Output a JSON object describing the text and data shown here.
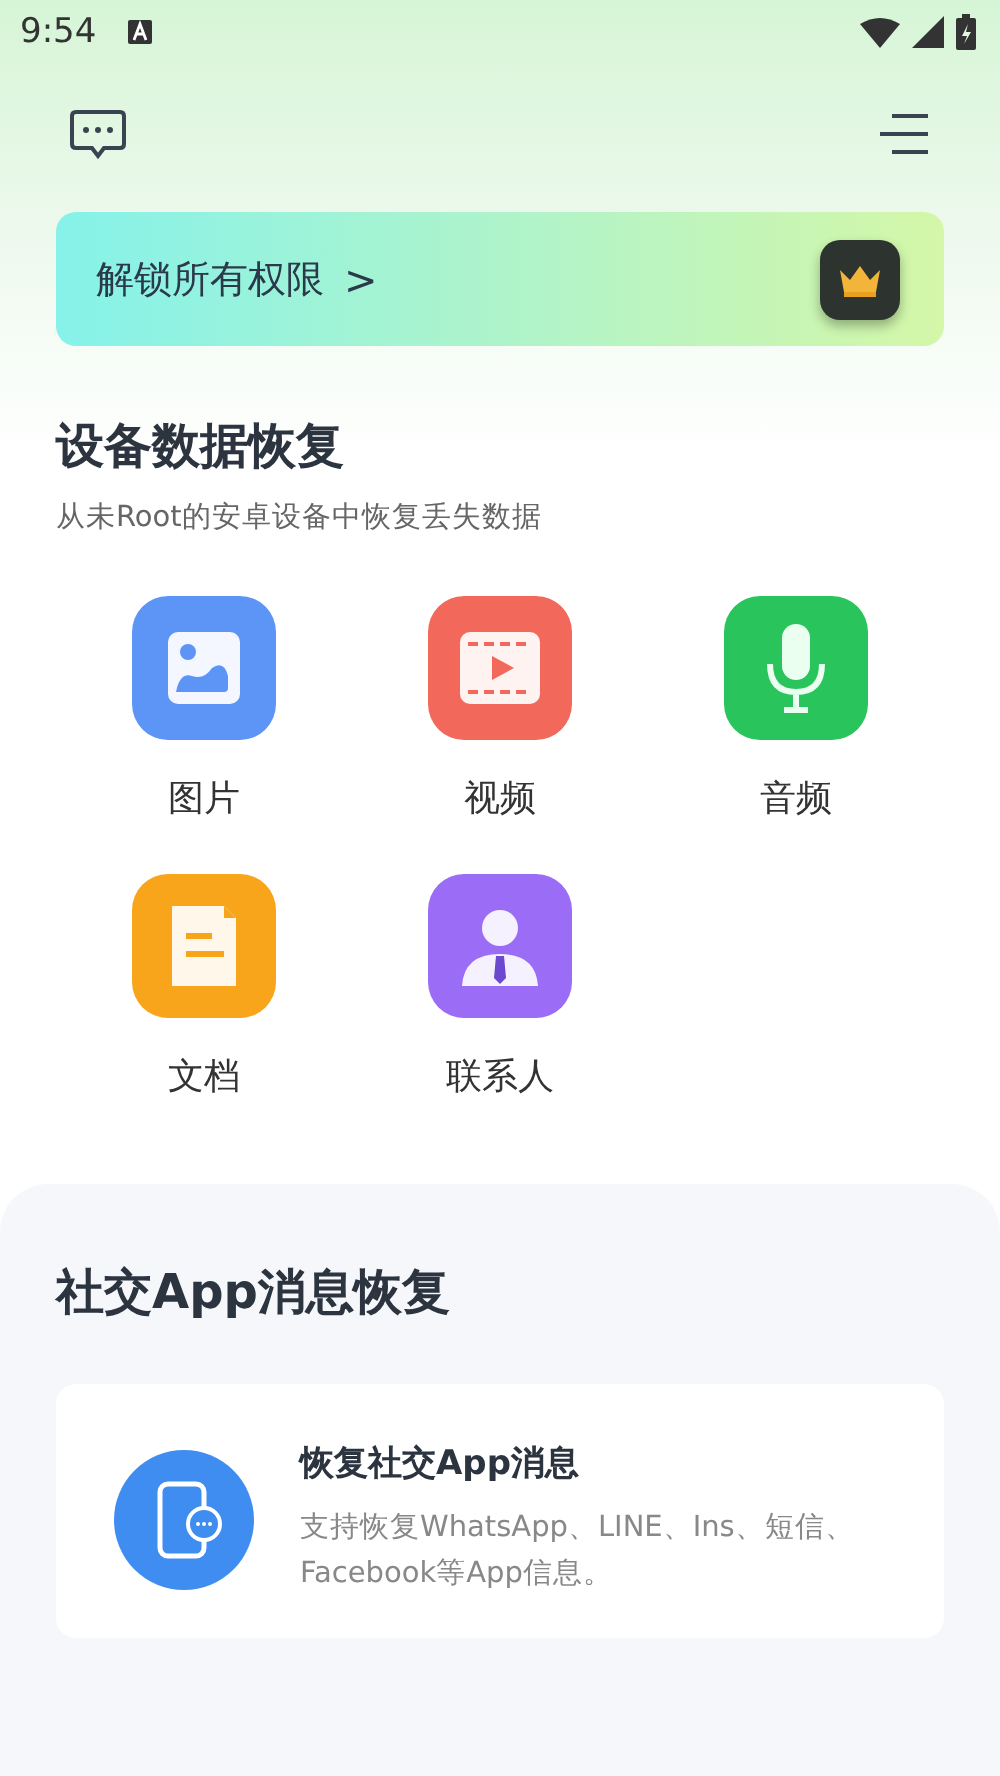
{
  "status_bar": {
    "time": "9:54"
  },
  "banner": {
    "text": "解锁所有权限",
    "arrow": ">"
  },
  "device_section": {
    "title": "设备数据恢复",
    "subtitle": "从未Root的安卓设备中恢复丢失数据",
    "items": [
      {
        "kind": "image",
        "label": "图片"
      },
      {
        "kind": "video",
        "label": "视频"
      },
      {
        "kind": "audio",
        "label": "音频"
      },
      {
        "kind": "document",
        "label": "文档"
      },
      {
        "kind": "contact",
        "label": "联系人"
      }
    ]
  },
  "social_section": {
    "title": "社交App消息恢复",
    "card": {
      "title": "恢复社交App消息",
      "description": "支持恢复WhatsApp、LINE、Ins、短信、Facebook等App信息。"
    }
  }
}
